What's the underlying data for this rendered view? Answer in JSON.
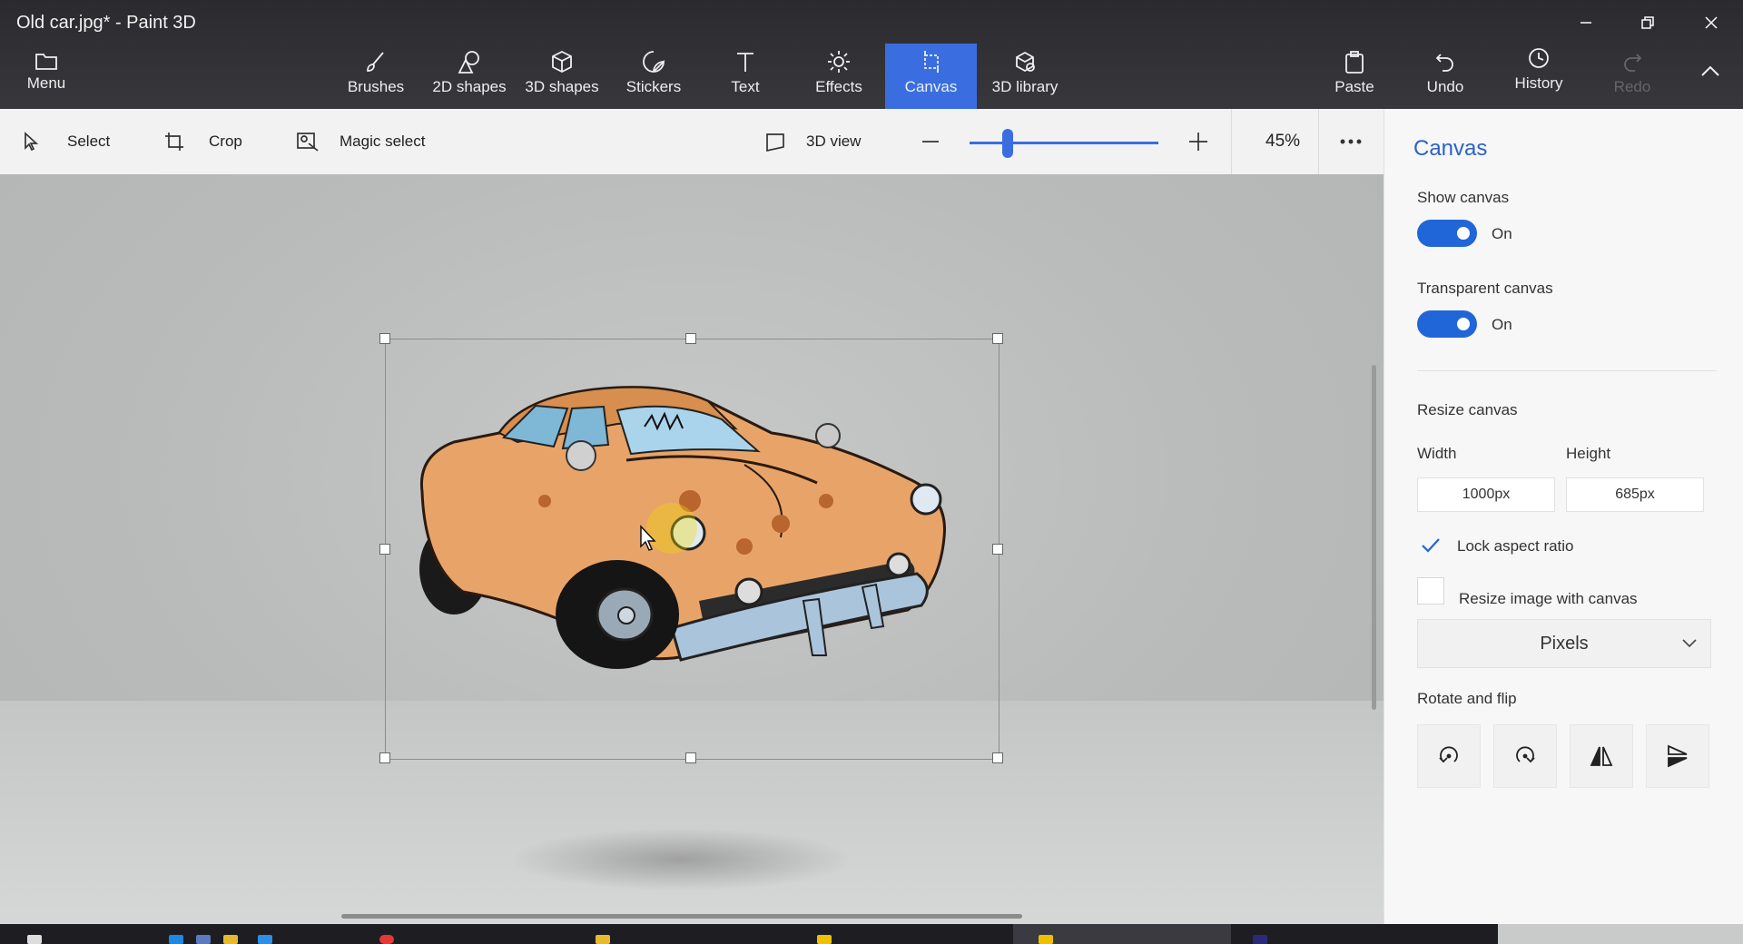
{
  "window": {
    "title": "Old car.jpg* - Paint 3D"
  },
  "ribbon": {
    "menu": "Menu",
    "tools": [
      "Brushes",
      "2D shapes",
      "3D shapes",
      "Stickers",
      "Text",
      "Effects",
      "Canvas",
      "3D library"
    ],
    "active_tool": "Canvas",
    "paste": "Paste",
    "undo": "Undo",
    "history": "History",
    "redo": "Redo"
  },
  "toolbar": {
    "select": "Select",
    "crop": "Crop",
    "magic_select": "Magic select",
    "view_3d": "3D view",
    "zoom": "45%",
    "zoom_slider_fraction": 0.2
  },
  "panel": {
    "title": "Canvas",
    "show_canvas": {
      "label": "Show canvas",
      "state": "On"
    },
    "transparent_canvas": {
      "label": "Transparent canvas",
      "state": "On"
    },
    "resize_title": "Resize canvas",
    "width_label": "Width",
    "height_label": "Height",
    "width_value": "1000px",
    "height_value": "685px",
    "lock_aspect": "Lock aspect ratio",
    "resize_image": "Resize image with canvas",
    "units": "Pixels",
    "rotate_title": "Rotate and flip"
  },
  "colors": {
    "accent": "#3a6ee0",
    "toggle": "#2166d8",
    "title": "#2c62c8"
  }
}
